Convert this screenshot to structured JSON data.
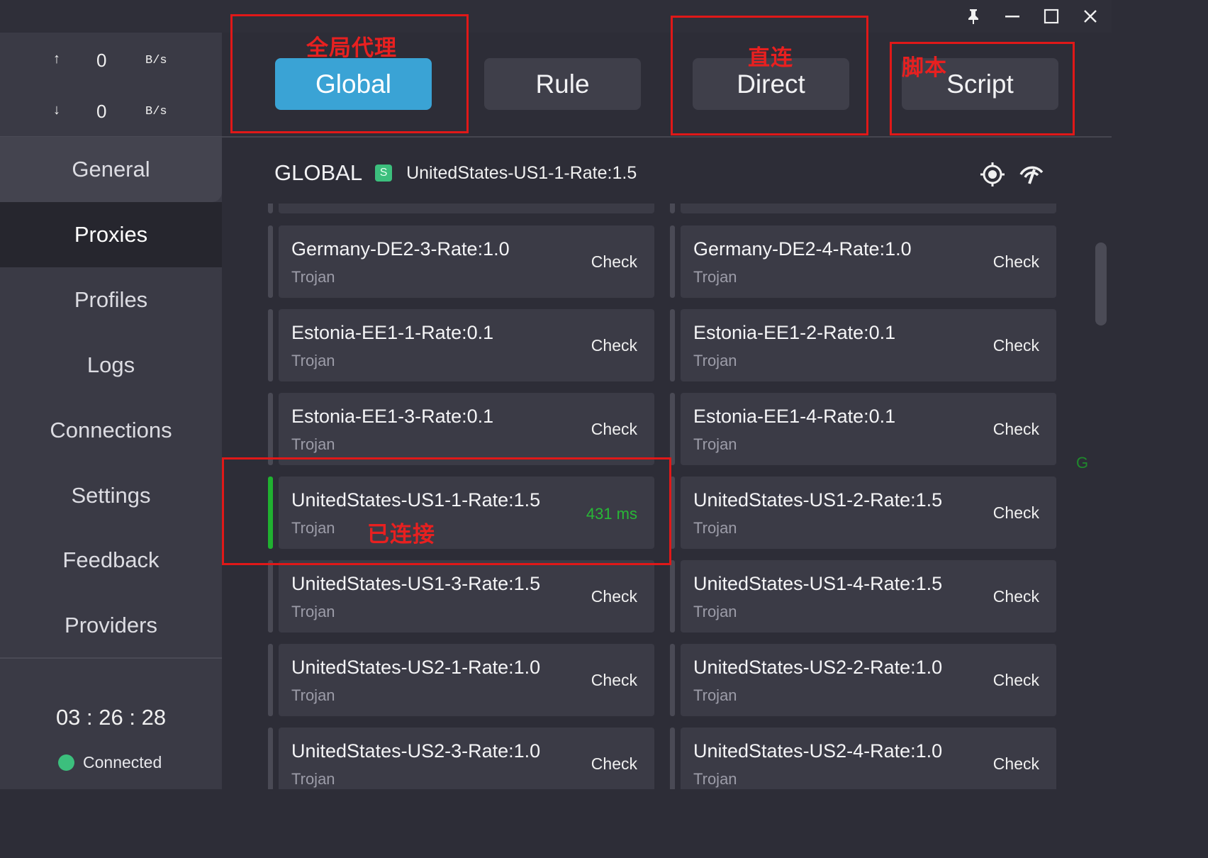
{
  "window": {
    "buttons": [
      {
        "name": "pin-icon"
      },
      {
        "name": "minimize-icon"
      },
      {
        "name": "maximize-icon"
      },
      {
        "name": "close-icon"
      }
    ]
  },
  "traffic": {
    "upload": {
      "arrow": "↑",
      "value": "0",
      "unit": "B/s"
    },
    "download": {
      "arrow": "↓",
      "value": "0",
      "unit": "B/s"
    }
  },
  "sidebar": {
    "items": [
      {
        "label": "General"
      },
      {
        "label": "Proxies",
        "active": true
      },
      {
        "label": "Profiles"
      },
      {
        "label": "Logs"
      },
      {
        "label": "Connections"
      },
      {
        "label": "Settings"
      },
      {
        "label": "Feedback"
      },
      {
        "label": "Providers"
      }
    ],
    "timer": "03 : 26 : 28",
    "status": "Connected",
    "status_color": "#3cbf7d"
  },
  "modes": {
    "global": "Global",
    "rule": "Rule",
    "direct": "Direct",
    "script": "Script",
    "active": "Global",
    "active_color": "#3aa3d5"
  },
  "annotations": {
    "global": "全局代理",
    "direct": "直连",
    "script": "脚本",
    "connected": "已连接",
    "color": "#e01818"
  },
  "group": {
    "name": "GLOBAL",
    "badge": "S",
    "current": "UnitedStates-US1-1-Rate:1.5",
    "icons": [
      "locate-icon",
      "speed-test-icon"
    ]
  },
  "proxies": [
    {
      "name": "Germany-DE2-3-Rate:1.0",
      "type": "Trojan",
      "check": "Check"
    },
    {
      "name": "Germany-DE2-4-Rate:1.0",
      "type": "Trojan",
      "check": "Check"
    },
    {
      "name": "Estonia-EE1-1-Rate:0.1",
      "type": "Trojan",
      "check": "Check"
    },
    {
      "name": "Estonia-EE1-2-Rate:0.1",
      "type": "Trojan",
      "check": "Check"
    },
    {
      "name": "Estonia-EE1-3-Rate:0.1",
      "type": "Trojan",
      "check": "Check"
    },
    {
      "name": "Estonia-EE1-4-Rate:0.1",
      "type": "Trojan",
      "check": "Check"
    },
    {
      "name": "UnitedStates-US1-1-Rate:1.5",
      "type": "Trojan",
      "latency": "431 ms",
      "selected": true
    },
    {
      "name": "UnitedStates-US1-2-Rate:1.5",
      "type": "Trojan",
      "check": "Check"
    },
    {
      "name": "UnitedStates-US1-3-Rate:1.5",
      "type": "Trojan",
      "check": "Check"
    },
    {
      "name": "UnitedStates-US1-4-Rate:1.5",
      "type": "Trojan",
      "check": "Check"
    },
    {
      "name": "UnitedStates-US2-1-Rate:1.0",
      "type": "Trojan",
      "check": "Check"
    },
    {
      "name": "UnitedStates-US2-2-Rate:1.0",
      "type": "Trojan",
      "check": "Check"
    },
    {
      "name": "UnitedStates-US2-3-Rate:1.0",
      "type": "Trojan",
      "check": "Check"
    },
    {
      "name": "UnitedStates-US2-4-Rate:1.0",
      "type": "Trojan",
      "check": "Check"
    }
  ],
  "side_letter": "G"
}
